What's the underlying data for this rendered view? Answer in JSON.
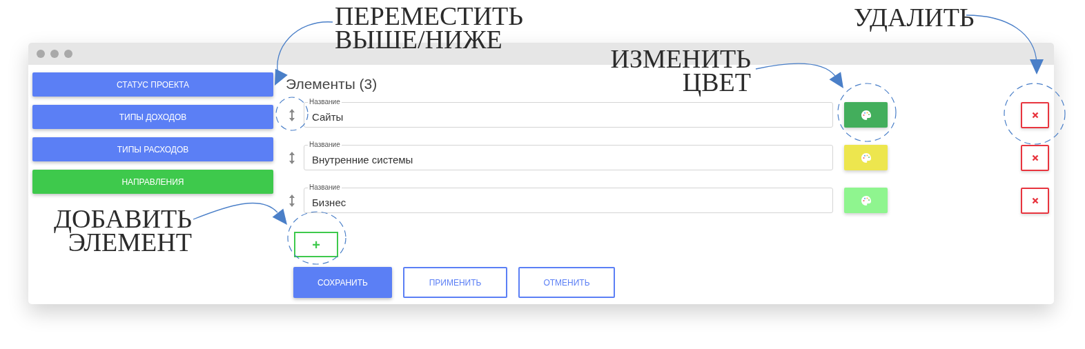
{
  "sidebar": {
    "items": [
      {
        "label": "СТАТУС ПРОЕКТА",
        "selected": false
      },
      {
        "label": "ТИПЫ ДОХОДОВ",
        "selected": false
      },
      {
        "label": "ТИПЫ РАСХОДОВ",
        "selected": false
      },
      {
        "label": "НАПРАВЛЕНИЯ",
        "selected": true
      }
    ]
  },
  "content": {
    "heading": "Элементы (3)",
    "rows": [
      {
        "label": "Название",
        "value": "Сайты",
        "color": "#43ae5c"
      },
      {
        "label": "Название",
        "value": "Внутренние системы",
        "color": "#ede64e"
      },
      {
        "label": "Название",
        "value": "Бизнес",
        "color": "#8ff58f"
      }
    ],
    "add_button": "+",
    "actions": [
      {
        "label": "СОХРАНИТЬ",
        "kind": "primary"
      },
      {
        "label": "ПРИМЕНИТЬ",
        "kind": "outline"
      },
      {
        "label": "ОТМЕНИТЬ",
        "kind": "outline"
      }
    ]
  },
  "annotations": [
    {
      "lines": [
        "ПЕРЕМЕСТИТЬ",
        "ВЫШЕ/НИЖЕ"
      ],
      "kind": "move"
    },
    {
      "lines": [
        "ИЗМЕНИТЬ",
        "ЦВЕТ"
      ],
      "kind": "color"
    },
    {
      "lines": [
        "УДАЛИТЬ"
      ],
      "kind": "delete"
    },
    {
      "lines": [
        "ДОБАВИТЬ",
        "ЭЛЕМЕНТ"
      ],
      "kind": "add"
    }
  ]
}
